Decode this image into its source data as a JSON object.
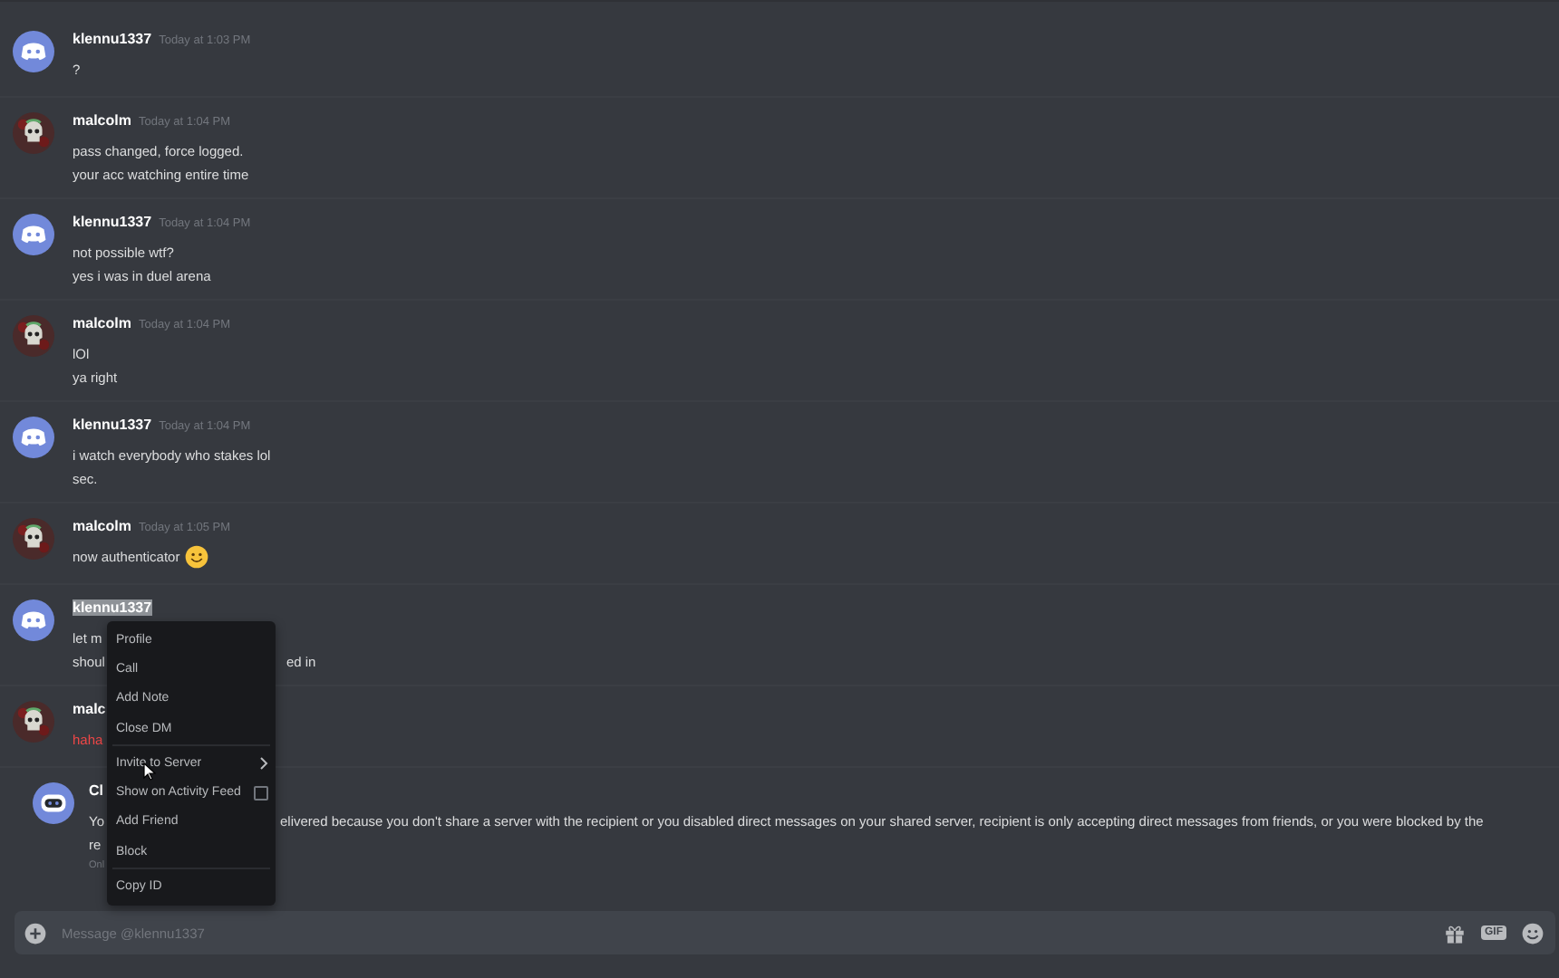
{
  "messages": [
    {
      "kind": "bot",
      "author": "klennu1337",
      "author_selected": false,
      "time": "Today at 1:03 PM",
      "lines": [
        [
          "?"
        ]
      ]
    },
    {
      "kind": "skull",
      "author": "malcolm",
      "author_selected": false,
      "time": "Today at 1:04 PM",
      "lines": [
        [
          "pass changed, force logged."
        ],
        [
          "your acc watching entire time"
        ]
      ]
    },
    {
      "kind": "bot",
      "author": "klennu1337",
      "author_selected": false,
      "time": "Today at 1:04 PM",
      "lines": [
        [
          "not possible wtf?"
        ],
        [
          "yes i was in duel arena"
        ]
      ]
    },
    {
      "kind": "skull",
      "author": "malcolm",
      "author_selected": false,
      "time": "Today at 1:04 PM",
      "lines": [
        [
          "lOl"
        ],
        [
          "ya right"
        ]
      ]
    },
    {
      "kind": "bot",
      "author": "klennu1337",
      "author_selected": false,
      "time": "Today at 1:04 PM",
      "lines": [
        [
          "i watch everybody who stakes lol"
        ],
        [
          "sec."
        ]
      ]
    },
    {
      "kind": "skull",
      "author": "malcolm",
      "author_selected": false,
      "time": "Today at 1:05 PM",
      "lines": [
        [
          "now authenticator"
        ]
      ],
      "emoji": true
    },
    {
      "kind": "bot",
      "author": "klennu1337",
      "author_selected": true,
      "lines": [
        [
          "let m"
        ],
        [
          "shoul",
          "ed in"
        ]
      ]
    },
    {
      "kind": "skull",
      "author": "malc",
      "author_selected": false,
      "lines": [
        [
          "haha"
        ]
      ],
      "error": true
    }
  ],
  "system_message": {
    "author": "Cl",
    "lines": [
      [
        "Yo",
        "elivered because you don't share a server with the recipient or you disabled direct messages on your shared server, recipient is only accepting direct messages from friends, or you were blocked by the"
      ],
      [
        "re"
      ]
    ],
    "note": "Onl"
  },
  "composer": {
    "placeholder": "Message @klennu1337",
    "gif_label": "GIF"
  },
  "context_menu": [
    {
      "label": "Profile",
      "kind": "item"
    },
    {
      "label": "Call",
      "kind": "item"
    },
    {
      "label": "Add Note",
      "kind": "item"
    },
    {
      "label": "Close DM",
      "kind": "item",
      "divider_after": true
    },
    {
      "label": "Invite to Server",
      "kind": "submenu"
    },
    {
      "label": "Show on Activity Feed",
      "kind": "checkbox",
      "checked": false
    },
    {
      "label": "Add Friend",
      "kind": "item"
    },
    {
      "label": "Block",
      "kind": "item",
      "divider_after": true
    },
    {
      "label": "Copy ID",
      "kind": "item"
    }
  ]
}
